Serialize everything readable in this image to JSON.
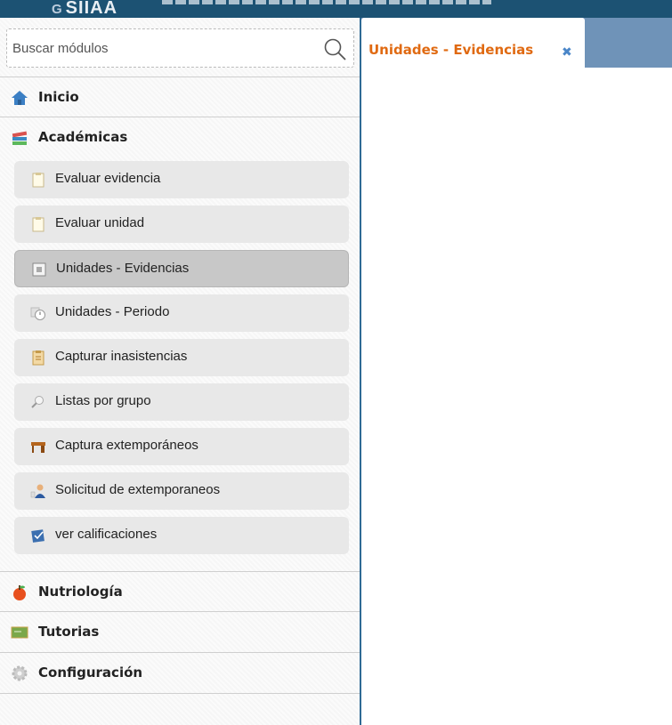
{
  "app": {
    "logo_text": "SIIAA",
    "logo_mark": "G"
  },
  "search": {
    "placeholder": "Buscar módulos"
  },
  "sidebar": {
    "sections": [
      {
        "label": "Inicio",
        "icon": "home-icon"
      },
      {
        "label": "Académicas",
        "icon": "books-icon"
      },
      {
        "label": "Nutriología",
        "icon": "apple-icon"
      },
      {
        "label": "Tutorias",
        "icon": "board-icon"
      },
      {
        "label": "Configuración",
        "icon": "gear-icon"
      }
    ],
    "items": [
      {
        "label": "Evaluar evidencia",
        "icon": "clipboard-icon"
      },
      {
        "label": "Evaluar unidad",
        "icon": "clipboard-icon"
      },
      {
        "label": "Unidades - Evidencias",
        "icon": "document-icon",
        "active": true
      },
      {
        "label": "Unidades - Periodo",
        "icon": "clock-icon"
      },
      {
        "label": "Capturar inasistencias",
        "icon": "clipboard-list-icon"
      },
      {
        "label": "Listas por grupo",
        "icon": "magnifier-icon"
      },
      {
        "label": "Captura extemporáneos",
        "icon": "desk-icon"
      },
      {
        "label": "Solicitud de extemporaneos",
        "icon": "user-request-icon"
      },
      {
        "label": "ver calificaciones",
        "icon": "grades-icon"
      }
    ]
  },
  "tabs": [
    {
      "label": "Unidades - Evidencias",
      "close": "✖"
    }
  ],
  "colors": {
    "header": "#1c5273",
    "tabbar": "#6f93b8",
    "active_tab_text": "#e06a12",
    "close": "#4a86c8",
    "active_item": "#c8c8c8"
  }
}
